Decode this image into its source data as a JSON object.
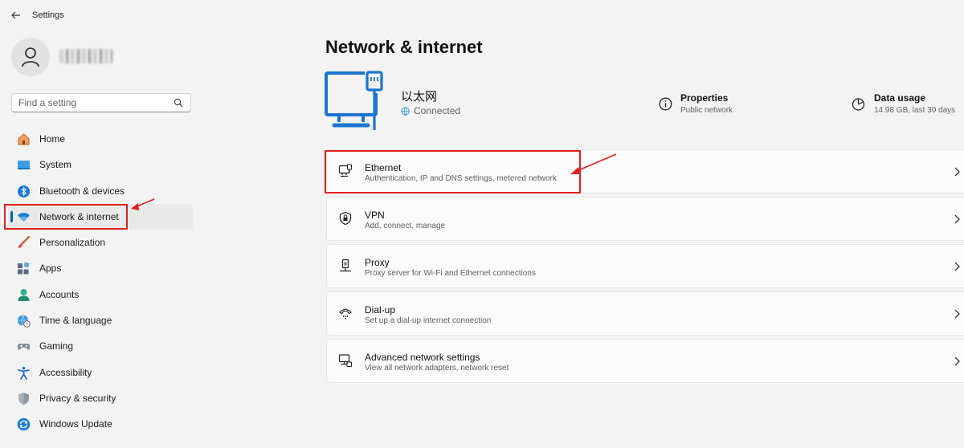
{
  "window": {
    "title": "Settings"
  },
  "search": {
    "placeholder": "Find a setting"
  },
  "sidebar": {
    "items": [
      {
        "label": "Home",
        "icon": "home-icon",
        "active": false
      },
      {
        "label": "System",
        "icon": "system-icon",
        "active": false
      },
      {
        "label": "Bluetooth & devices",
        "icon": "bluetooth-icon",
        "active": false
      },
      {
        "label": "Network & internet",
        "icon": "wifi-icon",
        "active": true
      },
      {
        "label": "Personalization",
        "icon": "brush-icon",
        "active": false
      },
      {
        "label": "Apps",
        "icon": "apps-icon",
        "active": false
      },
      {
        "label": "Accounts",
        "icon": "person-icon",
        "active": false
      },
      {
        "label": "Time & language",
        "icon": "globe-clock-icon",
        "active": false
      },
      {
        "label": "Gaming",
        "icon": "gamepad-icon",
        "active": false
      },
      {
        "label": "Accessibility",
        "icon": "accessibility-icon",
        "active": false
      },
      {
        "label": "Privacy & security",
        "icon": "shield-icon",
        "active": false
      },
      {
        "label": "Windows Update",
        "icon": "update-icon",
        "active": false
      }
    ]
  },
  "main": {
    "title": "Network & internet",
    "connection": {
      "name": "以太网",
      "status": "Connected"
    },
    "properties": {
      "title": "Properties",
      "subtitle": "Public network"
    },
    "data_usage": {
      "title": "Data usage",
      "subtitle": "14.98 GB, last 30 days"
    },
    "cards": [
      {
        "title": "Ethernet",
        "subtitle": "Authentication, IP and DNS settings, metered network",
        "icon": "ethernet-icon"
      },
      {
        "title": "VPN",
        "subtitle": "Add, connect, manage",
        "icon": "vpn-shield-icon"
      },
      {
        "title": "Proxy",
        "subtitle": "Proxy server for Wi-Fi and Ethernet connections",
        "icon": "proxy-icon"
      },
      {
        "title": "Dial-up",
        "subtitle": "Set up a dial-up internet connection",
        "icon": "dialup-icon"
      },
      {
        "title": "Advanced network settings",
        "subtitle": "View all network adapters, network reset",
        "icon": "advanced-network-icon"
      }
    ]
  },
  "colors": {
    "accent": "#005fb8",
    "annotation": "#e0201e",
    "background": "#f3f3f3"
  }
}
